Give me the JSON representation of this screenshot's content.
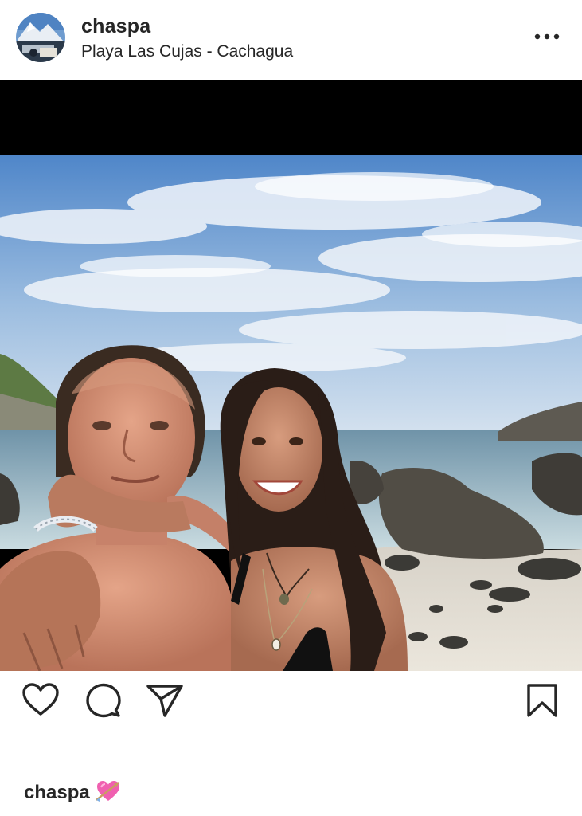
{
  "post": {
    "username": "chaspa",
    "location": "Playa Las Cujas - Cachagua",
    "more_icon": "more-horizontal-icon",
    "media_alt": "Selfie of a smiling couple on a rocky beach"
  },
  "actions": {
    "like_icon": "heart-icon",
    "comment_icon": "comment-icon",
    "share_icon": "paper-plane-icon",
    "save_icon": "bookmark-icon"
  },
  "caption": {
    "username": "chaspa",
    "emoji_icon": "heart-with-arrow-icon"
  },
  "colors": {
    "text": "#262626",
    "background": "#ffffff",
    "media_letterbox": "#000000",
    "emoji_pink": "#f060b0"
  }
}
